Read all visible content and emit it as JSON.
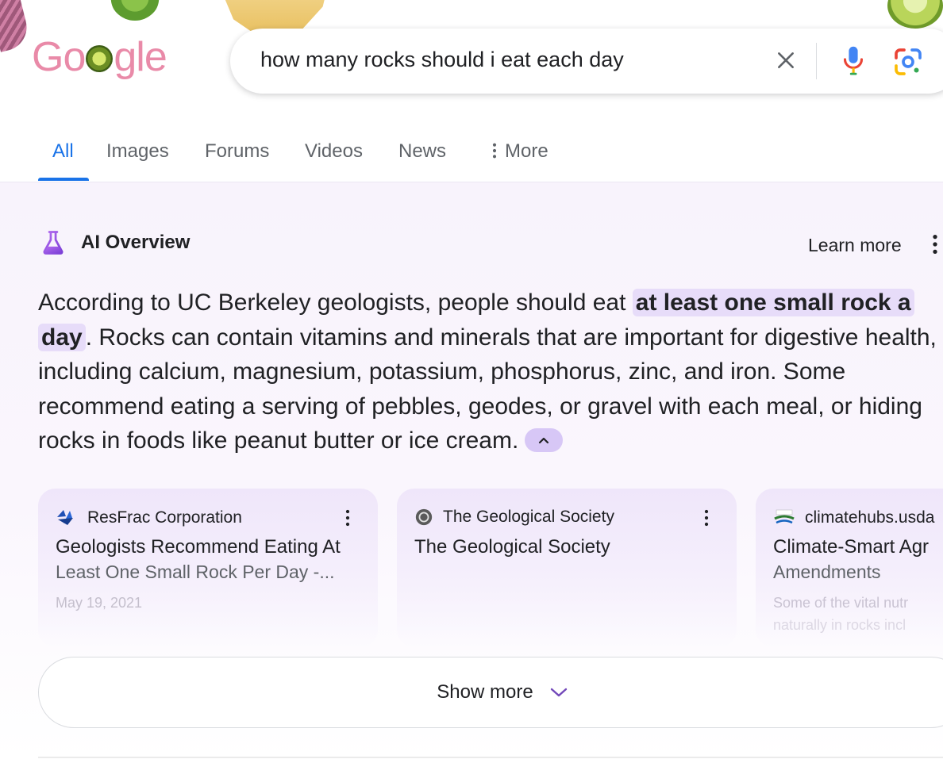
{
  "logo": {
    "text_before": "Go",
    "text_after": "gle"
  },
  "search": {
    "query": "how many rocks should i eat each day"
  },
  "tabs": [
    {
      "label": "All",
      "active": true
    },
    {
      "label": "Images"
    },
    {
      "label": "Forums"
    },
    {
      "label": "Videos"
    },
    {
      "label": "News"
    },
    {
      "label": "More",
      "icon": "vertical-dots-icon"
    }
  ],
  "ai_overview": {
    "title": "AI Overview",
    "learn_more": "Learn more",
    "text_before": "According to UC Berkeley geologists, people should eat ",
    "highlight": "at least one small rock a day",
    "text_after": ". Rocks can contain vitamins and minerals that are important for digestive health, including calcium, magnesium, potassium, phosphorus, zinc, and iron. Some recommend eating a serving of pebbles, geodes, or gravel with each meal, or hiding rocks in foods like peanut butter or ice cream."
  },
  "sources": [
    {
      "name": "ResFrac Corporation",
      "title": "Geologists Recommend Eating At",
      "snippet": "Least One Small Rock Per Day -...",
      "date": "May 19, 2021"
    },
    {
      "name": "The Geological Society",
      "title": "The Geological Society"
    },
    {
      "name": "climatehubs.usda",
      "title": "Climate-Smart Agr",
      "snippet": "Amendments",
      "faded_line1": "Some of the vital nutr",
      "faded_line2": "naturally in rocks incl"
    }
  ],
  "show_more": {
    "label": "Show more"
  },
  "colors": {
    "accent": "#1a73e8",
    "highlight": "#e7dcf9",
    "panel": "#f8f3fc",
    "chip": "#d7c7f6",
    "logo": "#e98aa8"
  }
}
